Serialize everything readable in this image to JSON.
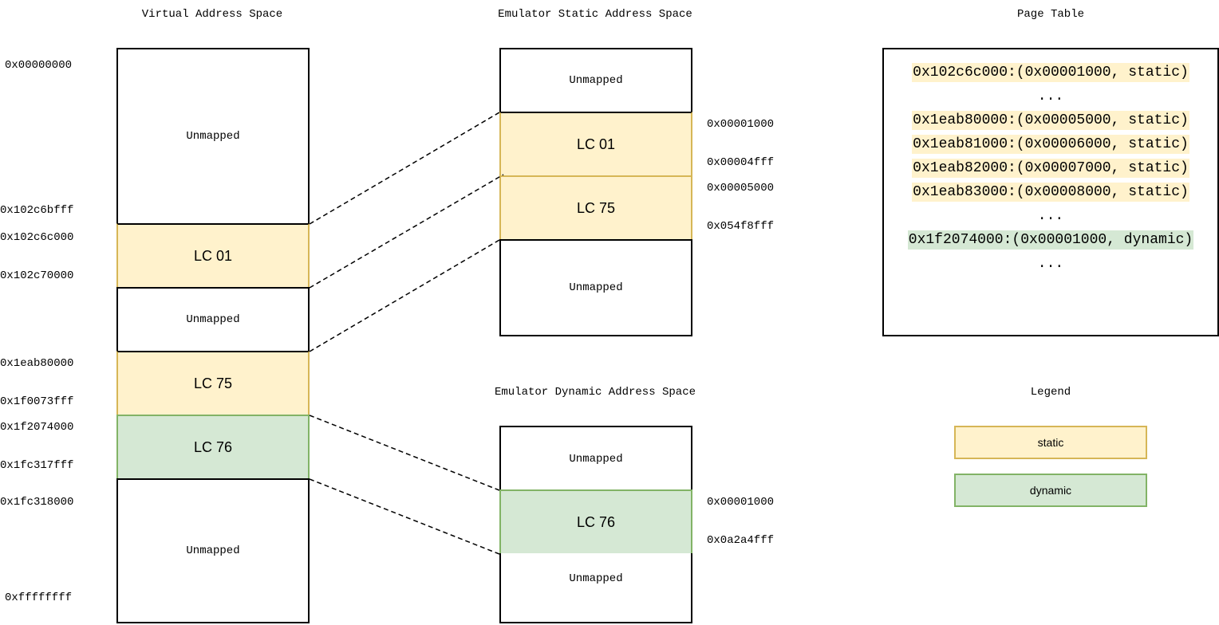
{
  "titles": {
    "virtual": "Virtual Address Space",
    "static": "Emulator Static Address Space",
    "dynamic": "Emulator Dynamic Address Space",
    "page_table": "Page Table",
    "legend": "Legend"
  },
  "virtual_space": {
    "blocks": [
      {
        "label": "Unmapped",
        "type": "unmapped"
      },
      {
        "label": "LC 01",
        "type": "static"
      },
      {
        "label": "Unmapped",
        "type": "unmapped"
      },
      {
        "label": "LC 75",
        "type": "static"
      },
      {
        "label": "LC 76",
        "type": "dynamic"
      },
      {
        "label": "Unmapped",
        "type": "unmapped"
      }
    ],
    "addresses": [
      "0x00000000",
      "0x102c6bfff",
      "0x102c6c000",
      "0x102c70000",
      "0x1eab80000",
      "0x1f0073fff",
      "0x1f2074000",
      "0x1fc317fff",
      "0x1fc318000",
      "0xffffffff"
    ]
  },
  "static_space": {
    "blocks": [
      {
        "label": "Unmapped",
        "type": "unmapped"
      },
      {
        "label": "LC 01",
        "type": "static"
      },
      {
        "label": "LC 75",
        "type": "static"
      },
      {
        "label": "Unmapped",
        "type": "unmapped"
      }
    ],
    "addresses": [
      "0x00001000",
      "0x00004fff",
      "0x00005000",
      "0x054f8fff"
    ]
  },
  "dynamic_space": {
    "blocks": [
      {
        "label": "Unmapped",
        "type": "unmapped"
      },
      {
        "label": "LC 76",
        "type": "dynamic"
      },
      {
        "label": "Unmapped",
        "type": "unmapped"
      }
    ],
    "addresses": [
      "0x00001000",
      "0x0a2a4fff"
    ]
  },
  "page_table": {
    "rows": [
      {
        "text": "0x102c6c000:(0x00001000, static)",
        "type": "static"
      },
      {
        "text": "...",
        "type": "ellipsis"
      },
      {
        "text": "0x1eab80000:(0x00005000, static)",
        "type": "static"
      },
      {
        "text": "0x1eab81000:(0x00006000, static)",
        "type": "static"
      },
      {
        "text": "0x1eab82000:(0x00007000, static)",
        "type": "static"
      },
      {
        "text": "0x1eab83000:(0x00008000, static)",
        "type": "static"
      },
      {
        "text": "...",
        "type": "ellipsis"
      },
      {
        "text": "0x1f2074000:(0x00001000, dynamic)",
        "type": "dynamic"
      },
      {
        "text": "...",
        "type": "ellipsis"
      }
    ]
  },
  "legend": {
    "items": [
      {
        "label": "static",
        "type": "static"
      },
      {
        "label": "dynamic",
        "type": "dynamic"
      }
    ]
  },
  "colors": {
    "static_fill": "#fff2cc",
    "static_border": "#d6b656",
    "dynamic_fill": "#d5e8d4",
    "dynamic_border": "#82b366"
  }
}
